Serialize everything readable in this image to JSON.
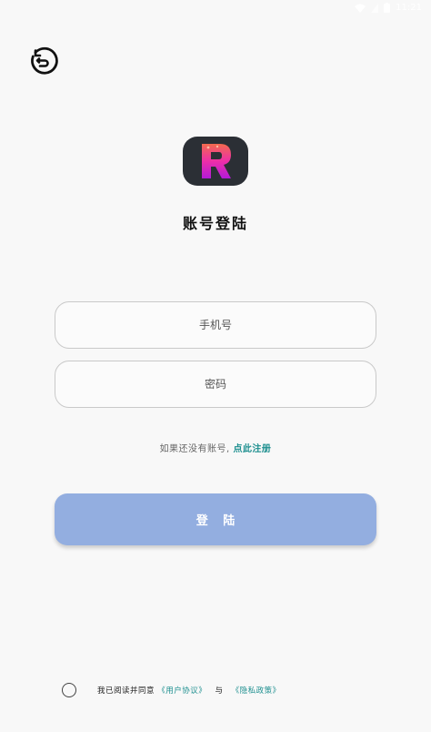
{
  "status_bar": {
    "time": "11:21"
  },
  "title": "账号登陆",
  "phone_field": {
    "placeholder": "手机号",
    "value": ""
  },
  "password_field": {
    "placeholder": "密码",
    "value": ""
  },
  "register_hint": {
    "text": "如果还没有账号,",
    "link": "点此注册"
  },
  "login_button": {
    "label": "登 陆"
  },
  "agreement": {
    "prefix": "我已阅读并同意",
    "user_agreement": "《用户协议》",
    "and": "与",
    "privacy_policy": "《隐私政策》"
  },
  "icons": {
    "back": "back-arrow-icon",
    "logo": "app-logo-icon",
    "wifi": "wifi-icon",
    "battery": "battery-icon"
  },
  "colors": {
    "accent_link": "#1d8f8f",
    "login_button_bg": "#93aee0",
    "logo_bg": "#2b2f35"
  }
}
